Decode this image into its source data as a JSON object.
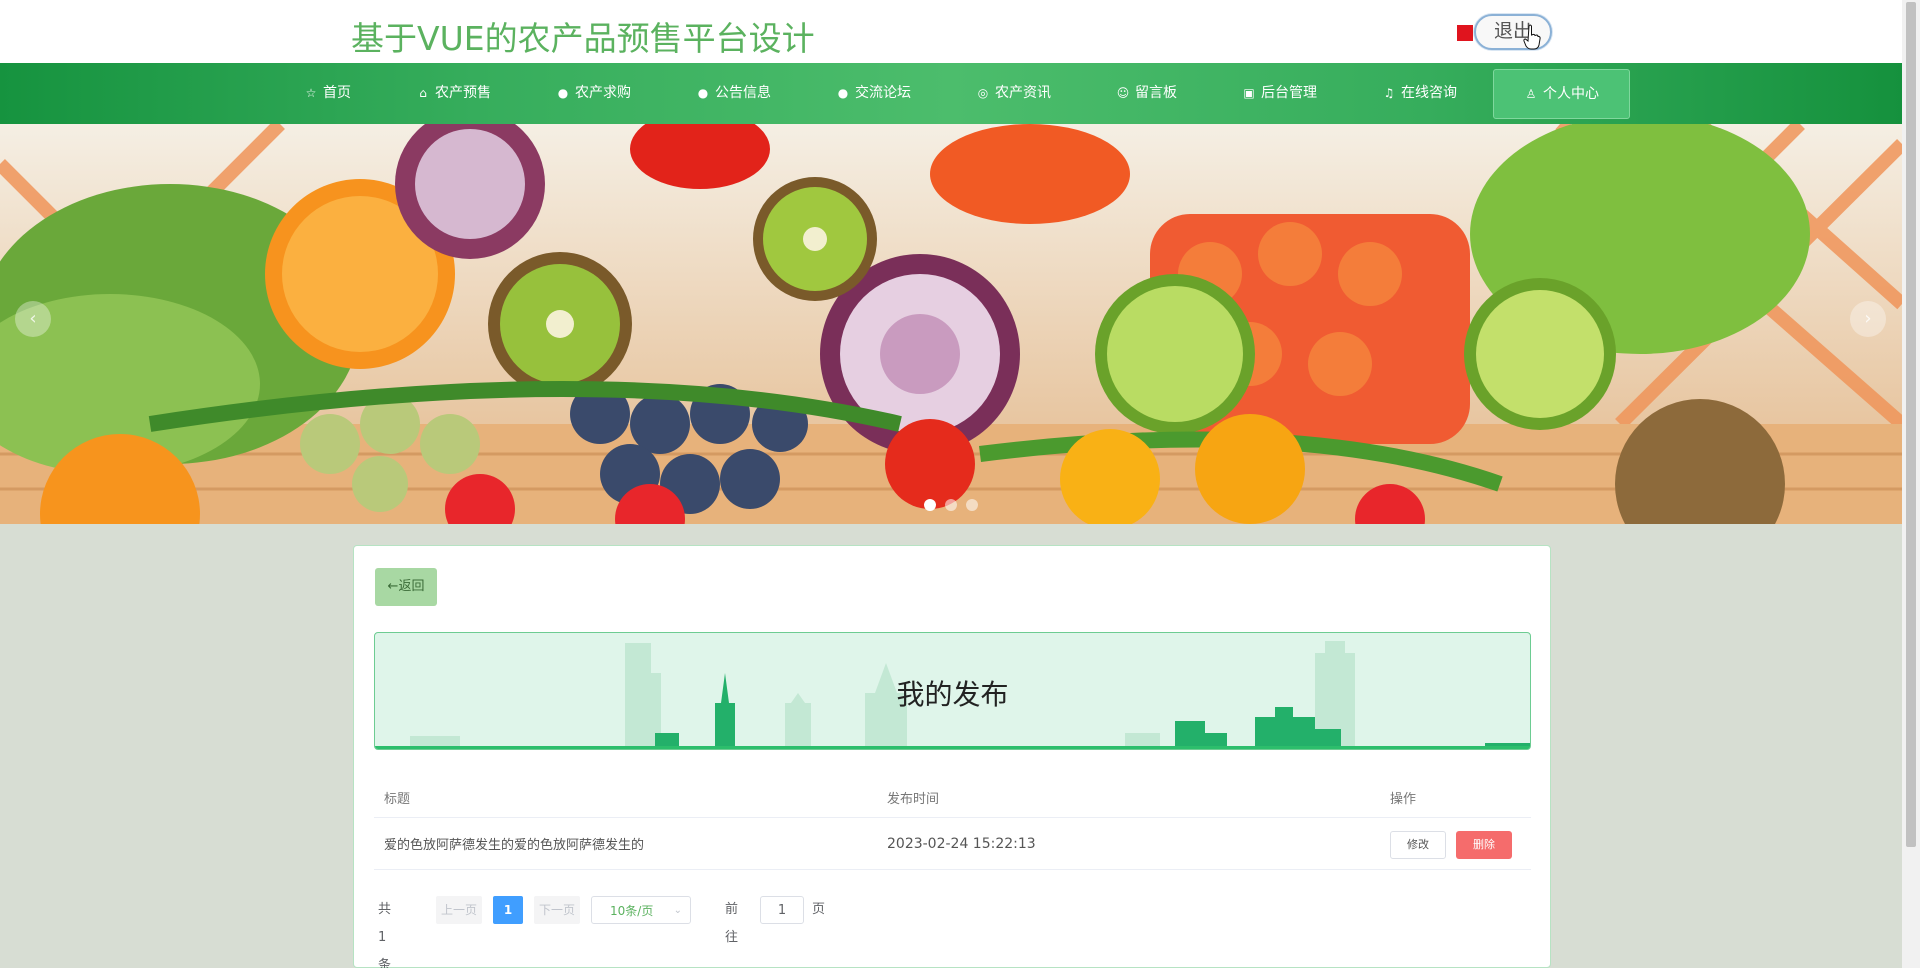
{
  "header": {
    "site_title": "基于VUE的农产品预售平台设计",
    "logout_label": "退出"
  },
  "nav": [
    {
      "label": "首页",
      "icon": "star-icon"
    },
    {
      "label": "农产预售",
      "icon": "bag-icon"
    },
    {
      "label": "农产求购",
      "icon": "info-icon"
    },
    {
      "label": "公告信息",
      "icon": "info-icon"
    },
    {
      "label": "交流论坛",
      "icon": "info-icon"
    },
    {
      "label": "农产资讯",
      "icon": "globe-icon"
    },
    {
      "label": "留言板",
      "icon": "smile-icon"
    },
    {
      "label": "后台管理",
      "icon": "box-icon"
    },
    {
      "label": "在线咨询",
      "icon": "headset-icon"
    },
    {
      "label": "个人中心",
      "icon": "user-icon",
      "active": true
    }
  ],
  "banner": {
    "slide_count": 3,
    "active_slide": 1
  },
  "page": {
    "back_label": "←返回",
    "hero_title": "我的发布"
  },
  "table": {
    "headers": [
      "标题",
      "发布时间",
      "操作"
    ],
    "rows": [
      {
        "title": "爱的色放阿萨德发生的爱的色放阿萨德发生的",
        "time": "2023-02-24 15:22:13",
        "edit_label": "修改",
        "delete_label": "删除"
      }
    ]
  },
  "pagination": {
    "total_text": "共 1 条",
    "prev_label": "上一页",
    "current_page": "1",
    "next_label": "下一页",
    "page_size": "10条/页",
    "goto_label": "前往",
    "goto_value": "1",
    "page_suffix": "页"
  },
  "colors": {
    "brand_green": "#16933f",
    "title_green": "#5bb25f",
    "danger": "#f56c6c",
    "primary": "#409eff"
  }
}
